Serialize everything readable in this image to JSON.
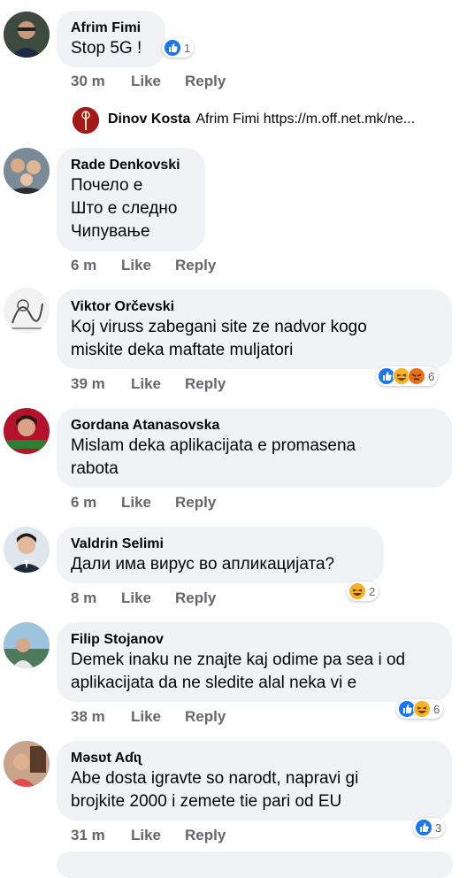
{
  "comments": [
    {
      "author": "Afrim Fimi",
      "text": "Stop 5G !",
      "time": "30 m",
      "like_label": "Like",
      "reply_label": "Reply",
      "reaction_count": "1",
      "reactions": [
        "like-icon"
      ]
    },
    {
      "author": "Rade Denkovski",
      "text": "Почело е\nШто е следно\nЧипување",
      "time": "6 m",
      "like_label": "Like",
      "reply_label": "Reply"
    },
    {
      "author": "Viktor Orčevski",
      "text": "Koj viruss zabegani site ze nadvor kogo\nmiskite deka maftate muljatori",
      "time": "39 m",
      "like_label": "Like",
      "reply_label": "Reply",
      "reaction_count": "6",
      "reactions": [
        "like-icon",
        "haha-icon",
        "angry-icon"
      ]
    },
    {
      "author": "Gordana Atanasovska",
      "text": "Mislam deka aplikacijata e promasena\nrabota",
      "time": "6 m",
      "like_label": "Like",
      "reply_label": "Reply"
    },
    {
      "author": "Valdrin Selimi",
      "text": "Дали има вирус во апликацијата?",
      "time": "8 m",
      "like_label": "Like",
      "reply_label": "Reply",
      "reaction_count": "2",
      "reactions": [
        "haha-icon"
      ]
    },
    {
      "author": "Filip Stojanov",
      "text": "Demek inaku ne znajte kaj odime pa sea i od\naplikacijata da ne sledite alal neka vi e",
      "time": "38 m",
      "like_label": "Like",
      "reply_label": "Reply",
      "reaction_count": "6",
      "reactions": [
        "like-icon",
        "haha-icon"
      ]
    },
    {
      "author": "Məsʋt Aɗɩʅ",
      "text": "Abe dosta igravte so narodt, napravi gi\nbrojkite 2000 i zemete tie pari od EU",
      "time": "31 m",
      "like_label": "Like",
      "reply_label": "Reply",
      "reaction_count": "3",
      "reactions": [
        "like-icon"
      ]
    }
  ],
  "reply_preview": {
    "author": "Dinov Kosta",
    "text": "Afrim Fimi https://m.off.net.mk/ne..."
  },
  "colors": {
    "bubble": "#f0f2f5",
    "meta": "#65676b",
    "like_blue": "#1877f2",
    "haha_yellow": "#f7b125",
    "angry_orange": "#e9710f"
  }
}
